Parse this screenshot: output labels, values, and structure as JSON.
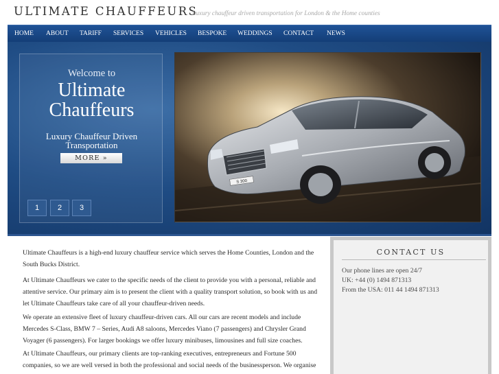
{
  "header": {
    "title": "ULTIMATE CHAUFFEURS",
    "tagline": "Luxury chauffeur driven transportation for London & the Home counties"
  },
  "nav": {
    "items": [
      "HOME",
      "ABOUT",
      "TARIFF",
      "SERVICES",
      "VEHICLES",
      "BESPOKE",
      "WEDDINGS",
      "CONTACT",
      "NEWS"
    ]
  },
  "hero": {
    "welcome": "Welcome to",
    "brand_line1": "Ultimate",
    "brand_line2": "Chauffeurs",
    "subtitle_line1": "Luxury Chauffeur Driven",
    "subtitle_line2": "Transportation",
    "more_label": "MORE »",
    "slides": [
      "1",
      "2",
      "3"
    ],
    "plate": "S 300"
  },
  "content": {
    "paragraphs": [
      "Ultimate Chauffeurs is a high-end luxury chauffeur service which serves the Home Counties, London and the South Bucks District.",
      "At Ultimate Chauffeurs we cater to the specific needs of the client to provide you with a personal, reliable and attentive service. Our primary aim is to present the client with a quality transport solution, so book with us and let Ultimate Chauffeurs take care of all your chauffeur-driven needs.",
      "We operate an extensive fleet of luxury chauffeur-driven cars. All our cars are recent models and include Mercedes S-Class, BMW 7 – Series, Audi A8 saloons, Mercedes Viano (7 passengers) and Chrysler Grand Voyager (6 passengers). For larger bookings we offer luxury minibuses, limousines and full size coaches.",
      "At Ultimate Chauffeurs, our primary clients are top-ranking executives, entrepreneurs and Fortune 500 companies, so we are well versed in both the professional and social needs of the businessperson. We organise and provide airport transfers to and from hotels, stations, private airports and ports. We can be 'on"
    ]
  },
  "sidebar": {
    "title": "CONTACT US",
    "line1": "Our phone lines are open 24/7",
    "line2": "UK: +44 (0) 1494 871313",
    "line3": "From the USA: 011 44 1494 871313"
  },
  "colors": {
    "nav_bg": "#1a4a8a",
    "hero_bg": "#1f4c84",
    "sidebar_bg": "#f1f1f1"
  }
}
